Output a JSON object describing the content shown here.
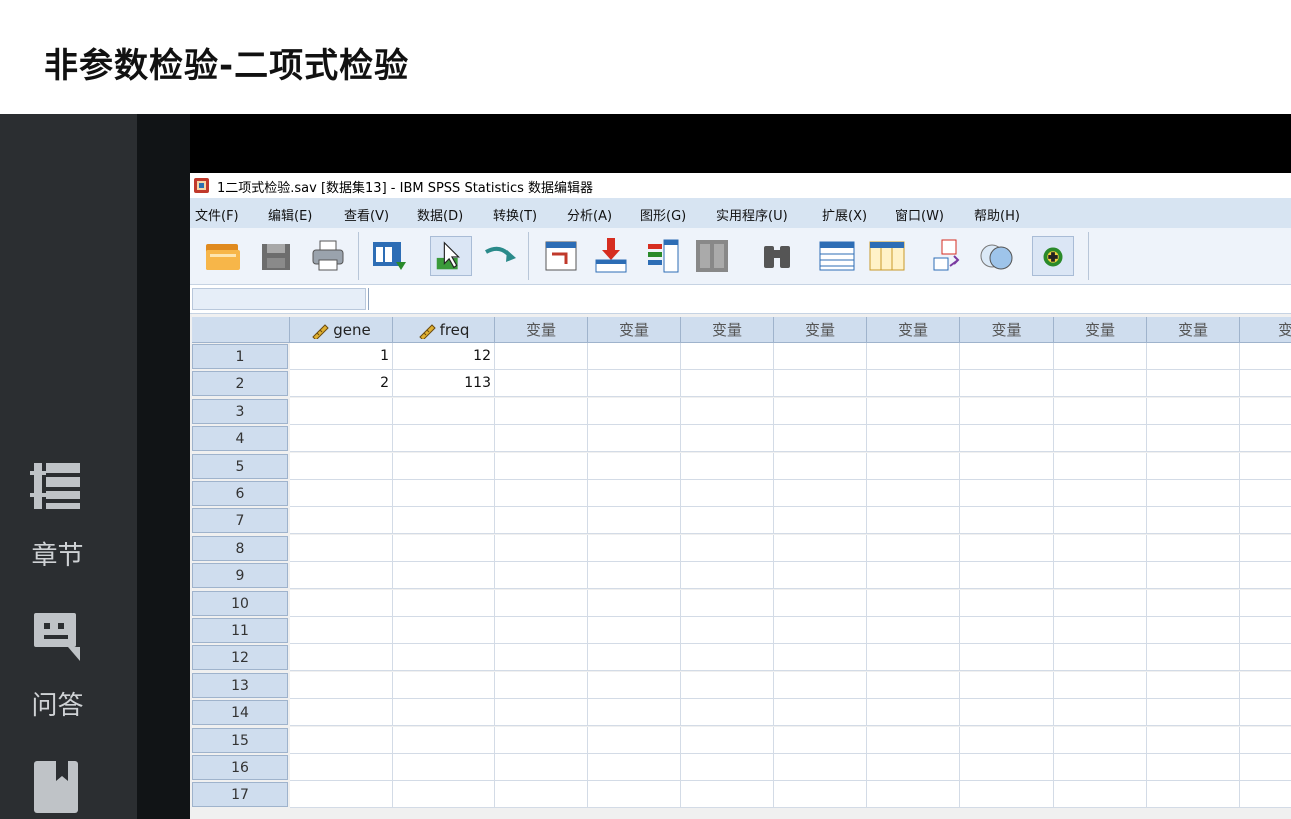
{
  "page": {
    "title": "非参数检验-二项式检验"
  },
  "sidebar": {
    "items": [
      {
        "label": "章节",
        "icon": "chapters-icon"
      },
      {
        "label": "问答",
        "icon": "qa-icon"
      },
      {
        "label": "",
        "icon": "notes-icon"
      }
    ]
  },
  "spss": {
    "window_title": "1二项式检验.sav [数据集13] - IBM SPSS Statistics 数据编辑器",
    "menu": [
      "文件(F)",
      "编辑(E)",
      "查看(V)",
      "数据(D)",
      "转换(T)",
      "分析(A)",
      "图形(G)",
      "实用程序(U)",
      "扩展(X)",
      "窗口(W)",
      "帮助(H)"
    ],
    "toolbar": [
      "open-icon",
      "save-icon",
      "print-icon",
      "dialog-recall-icon",
      "undo-icon",
      "redo-icon",
      "goto-case-icon",
      "goto-variable-icon",
      "variables-icon",
      "run-descriptives-icon",
      "find-icon",
      "insert-cases-icon",
      "insert-variable-icon",
      "split-file-icon",
      "weight-cases-icon",
      "select-cases-icon",
      "value-labels-icon"
    ],
    "columns": [
      "gene",
      "freq",
      "变量",
      "变量",
      "变量",
      "变量",
      "变量",
      "变量",
      "变量",
      "变量",
      "变"
    ],
    "rows": [
      [
        "1",
        "12"
      ],
      [
        "2",
        "113"
      ],
      [
        "",
        ""
      ],
      [
        "",
        ""
      ],
      [
        "",
        ""
      ],
      [
        "",
        ""
      ],
      [
        "",
        ""
      ],
      [
        "",
        ""
      ],
      [
        "",
        ""
      ],
      [
        "",
        ""
      ],
      [
        "",
        ""
      ],
      [
        "",
        ""
      ],
      [
        "",
        ""
      ],
      [
        "",
        ""
      ],
      [
        "",
        ""
      ],
      [
        "",
        ""
      ],
      [
        "",
        ""
      ]
    ],
    "row_numbers": [
      "1",
      "2",
      "3",
      "4",
      "5",
      "6",
      "7",
      "8",
      "9",
      "10",
      "11",
      "12",
      "13",
      "14",
      "15",
      "16",
      "17"
    ]
  },
  "colors": {
    "sidebar": "#2b2e31",
    "menubar": "#d7e4f2",
    "header_cell": "#cfddee"
  }
}
